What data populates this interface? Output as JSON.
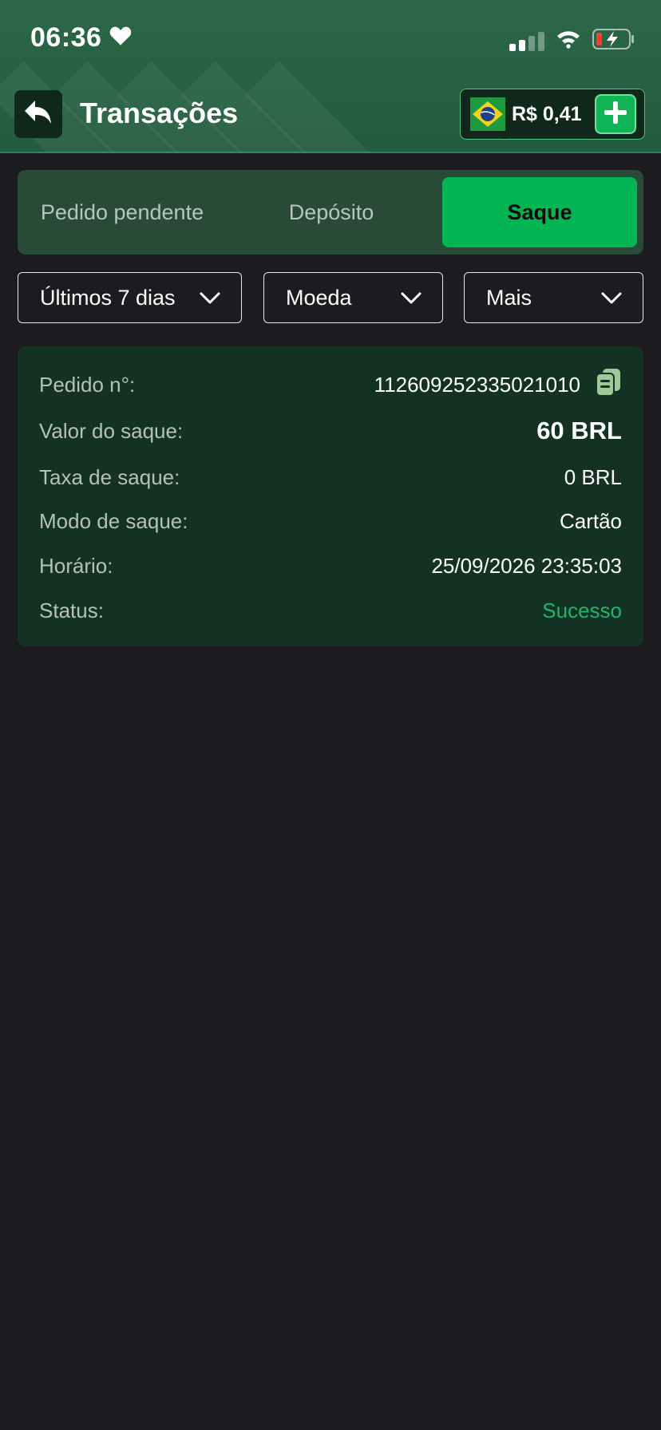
{
  "status_bar": {
    "time": "06:36"
  },
  "header": {
    "title": "Transações",
    "balance": "R$ 0,41"
  },
  "tabs": [
    {
      "label": "Pedido pendente",
      "active": false
    },
    {
      "label": "Depósito",
      "active": false
    },
    {
      "label": "Saque",
      "active": true
    }
  ],
  "filters": {
    "period": "Últimos 7 dias",
    "currency": "Moeda",
    "more": "Mais"
  },
  "transaction": {
    "order_label": "Pedido n°:",
    "order_value": "112609252335021010",
    "amount_label": "Valor do saque:",
    "amount_value": "60 BRL",
    "fee_label": "Taxa de saque:",
    "fee_value": "0 BRL",
    "mode_label": "Modo de saque:",
    "mode_value": "Cartão",
    "time_label": "Horário:",
    "time_value": "25/09/2026 23:35:03",
    "status_label": "Status:",
    "status_value": "Sucesso"
  },
  "colors": {
    "accent": "#04b554",
    "header_bg": "#2b6748",
    "card_bg": "#143223",
    "success": "#1fb56a",
    "page_bg": "#1c1c20"
  }
}
